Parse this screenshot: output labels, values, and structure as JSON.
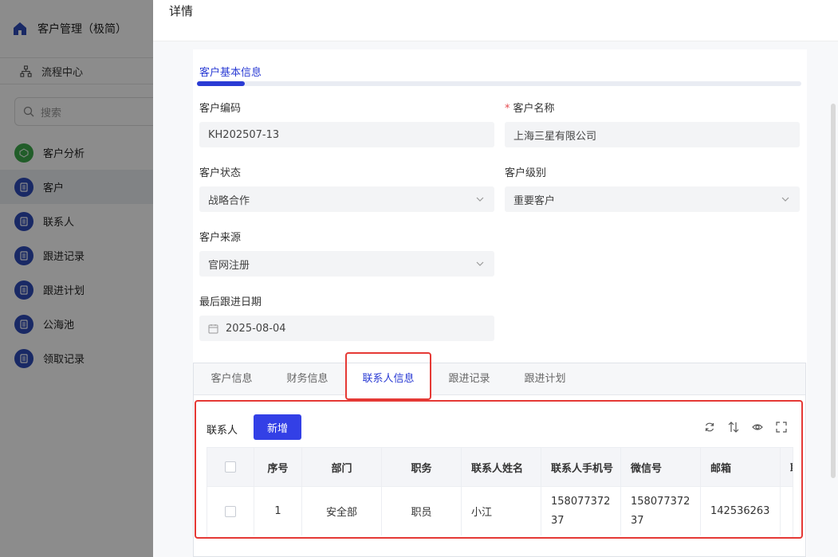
{
  "sidebar": {
    "brand": "客户管理（极简）",
    "flow_center": "流程中心",
    "search_placeholder": "搜索",
    "items": [
      {
        "label": "客户分析",
        "icon": "analytics-icon"
      },
      {
        "label": "客户",
        "icon": "list-icon"
      },
      {
        "label": "联系人",
        "icon": "list-icon"
      },
      {
        "label": "跟进记录",
        "icon": "list-icon"
      },
      {
        "label": "跟进计划",
        "icon": "list-icon"
      },
      {
        "label": "公海池",
        "icon": "list-icon"
      },
      {
        "label": "领取记录",
        "icon": "list-icon"
      }
    ],
    "active_index": 1
  },
  "drawer": {
    "title": "详情",
    "section_title": "客户基本信息",
    "fields": {
      "code_label": "客户编码",
      "code_value": "KH202507-13",
      "name_label": "客户名称",
      "name_required": "*",
      "name_value": "上海三星有限公司",
      "status_label": "客户状态",
      "status_value": "战略合作",
      "level_label": "客户级别",
      "level_value": "重要客户",
      "source_label": "客户来源",
      "source_value": "官网注册",
      "last_date_label": "最后跟进日期",
      "last_date_value": "2025-08-04"
    },
    "tabs": [
      "客户信息",
      "财务信息",
      "联系人信息",
      "跟进记录",
      "跟进计划"
    ],
    "active_tab": 2,
    "contacts": {
      "label": "联系人",
      "add_button": "新增",
      "columns": [
        "序号",
        "部门",
        "职务",
        "联系人姓名",
        "联系人手机号",
        "微信号",
        "邮箱",
        "联"
      ],
      "rows": [
        {
          "index": "1",
          "dept": "安全部",
          "title": "职员",
          "name": "小江",
          "phone": "15807737237",
          "wechat": "15807737237",
          "email": "142536263",
          "extra": ""
        }
      ]
    }
  },
  "colors": {
    "primary": "#3340e6",
    "highlight": "#e53935",
    "menu_icon": "#2f4bb8"
  }
}
